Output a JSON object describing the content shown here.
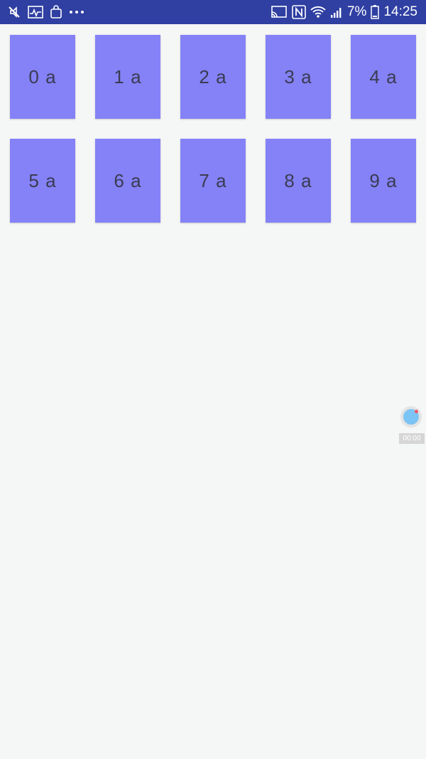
{
  "status_bar": {
    "battery_percent": "7%",
    "time": "14:25",
    "left_icons": [
      "mute-icon",
      "pulse-icon",
      "bag-icon",
      "more-icon"
    ],
    "right_icons": [
      "cast-icon",
      "nfc-icon",
      "wifi-icon",
      "signal-icon",
      "battery-icon"
    ],
    "background": "#2f3fa2"
  },
  "grid": {
    "tile_color": "#8482f6",
    "tiles": [
      {
        "label": "0 a"
      },
      {
        "label": "1 a"
      },
      {
        "label": "2 a"
      },
      {
        "label": "3 a"
      },
      {
        "label": "4 a"
      },
      {
        "label": "5 a"
      },
      {
        "label": "6 a"
      },
      {
        "label": "7 a"
      },
      {
        "label": "8 a"
      },
      {
        "label": "9 a"
      }
    ]
  },
  "recorder": {
    "timer": "00:00"
  }
}
